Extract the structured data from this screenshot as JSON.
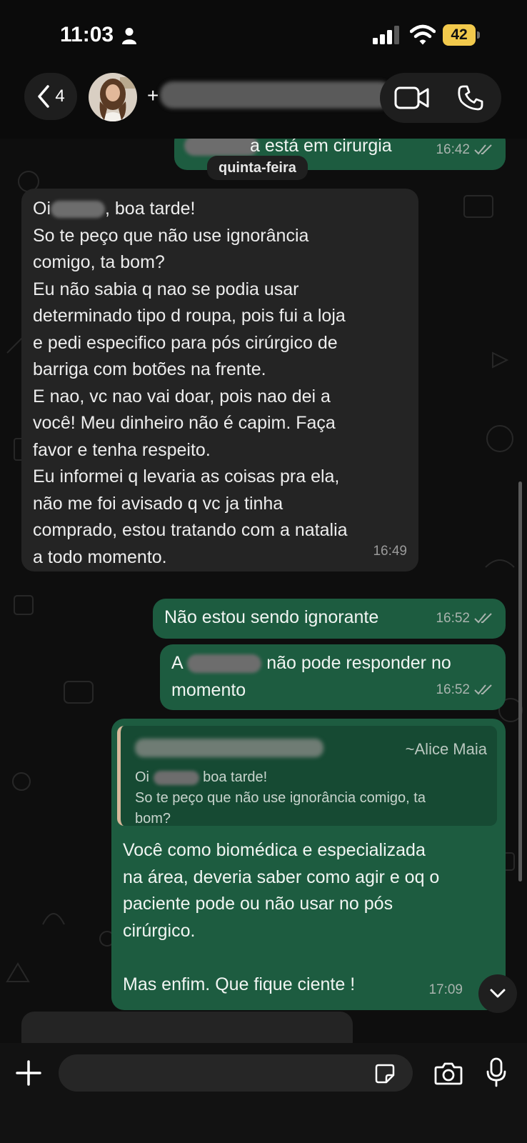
{
  "status": {
    "time": "11:03",
    "battery": "42"
  },
  "header": {
    "back_count": "4",
    "contact_prefix": "+",
    "icons": [
      "chevron-left-icon",
      "video-camera-icon",
      "phone-icon"
    ]
  },
  "chat": {
    "date_separator": "quinta-feira",
    "top_partial": {
      "text": "a está em cirurgia",
      "time": "16:42"
    },
    "incoming": {
      "lines": [
        "So te peço que não use ignorância",
        "comigo, ta bom?",
        "Eu não sabia q nao se podia usar",
        "determinado tipo d roupa, pois fui a loja",
        "e pedi especifico para pós cirúrgico de",
        "barriga com botões na frente.",
        "E nao, vc nao vai doar, pois nao dei a",
        "você! Meu dinheiro não é capim. Faça",
        "favor e tenha respeito.",
        "Eu informei q levaria as coisas pra ela,",
        "não me foi avisado q vc ja tinha",
        "comprado, estou tratando com a natalia",
        "a todo momento."
      ],
      "greeting_start": "Oi",
      "greeting_end": ", boa tarde!",
      "time": "16:49"
    },
    "out1": {
      "text": "Não estou sendo ignorante",
      "time": "16:52"
    },
    "out2": {
      "start": "A",
      "end": "não pode responder no",
      "line2": "momento",
      "time": "16:52"
    },
    "out3": {
      "quote_author": "~Alice Maia",
      "quote_start": "Oi",
      "quote_end": "boa tarde!",
      "quote_line2": "So te peço que não use ignorância comigo, ta",
      "quote_line3": "bom?",
      "lines": [
        "Você como biomédica e especializada",
        "na área, deveria saber como agir e oq o",
        "paciente pode ou não usar no pós",
        "cirúrgico."
      ],
      "final_line": "Mas enfim. Que fique ciente !",
      "time": "17:09"
    }
  },
  "composer": {
    "placeholder": ""
  },
  "colors": {
    "outgoing_bubble": "#1d5c40",
    "incoming_bubble": "#242424",
    "background": "#0e0e0e",
    "battery": "#f2c94c"
  }
}
